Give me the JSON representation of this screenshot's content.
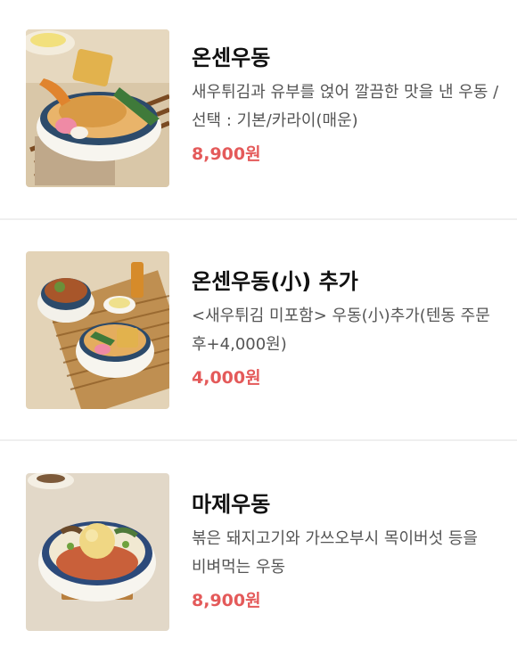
{
  "colors": {
    "price": "#e45a5a",
    "title": "#111111",
    "description": "#555555",
    "divider": "#efefef"
  },
  "menu": {
    "items": [
      {
        "name": "온센우동",
        "description": "새우튀김과 유부를 얹어 깔끔한 맛을 낸 우동 /선택 : 기본/카라이(매운)",
        "price": "8,900원",
        "image_icon": "udon-tempura-photo"
      },
      {
        "name": "온센우동(小) 추가",
        "description": "<새우튀김 미포함> 우동(小)추가(텐동 주문 후+4,000원)",
        "price": "4,000원",
        "image_icon": "udon-tendon-set-photo"
      },
      {
        "name": "마제우동",
        "description": "볶은 돼지고기와 가쓰오부시 목이버섯 등을 비벼먹는 우동",
        "price": "8,900원",
        "image_icon": "maze-udon-photo"
      }
    ]
  }
}
